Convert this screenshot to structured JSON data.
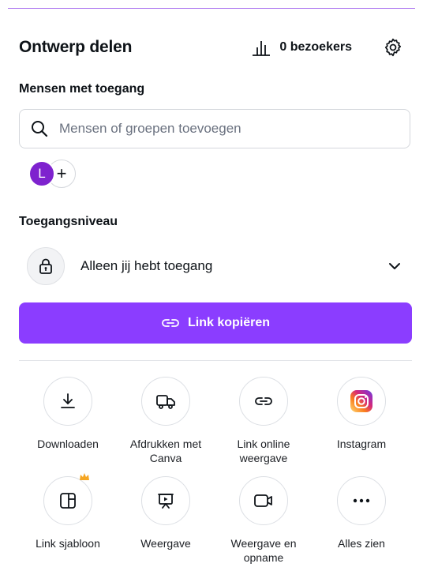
{
  "panel": {
    "title": "Ontwerp delen",
    "visitors_label": "0 bezoekers"
  },
  "people": {
    "section_label": "Mensen met toegang",
    "search_placeholder": "Mensen of groepen toevoegen",
    "avatar_initial": "L",
    "avatar_color": "#7e22ce",
    "add_symbol": "+"
  },
  "access": {
    "section_label": "Toegangsniveau",
    "level_text": "Alleen jij hebt toegang"
  },
  "copy_link": {
    "label": "Link kopiëren",
    "color": "#8b3dff"
  },
  "share_options": [
    {
      "label": "Downloaden",
      "icon": "download-icon"
    },
    {
      "label": "Afdrukken met Canva",
      "icon": "truck-icon"
    },
    {
      "label": "Link online weergave",
      "icon": "link-icon"
    },
    {
      "label": "Instagram",
      "icon": "instagram-icon"
    },
    {
      "label": "Link sjabloon",
      "icon": "template-icon"
    },
    {
      "label": "Weergave",
      "icon": "present-icon"
    },
    {
      "label": "Weergave en opname",
      "icon": "video-record-icon"
    },
    {
      "label": "Alles zien",
      "icon": "more-icon"
    }
  ]
}
